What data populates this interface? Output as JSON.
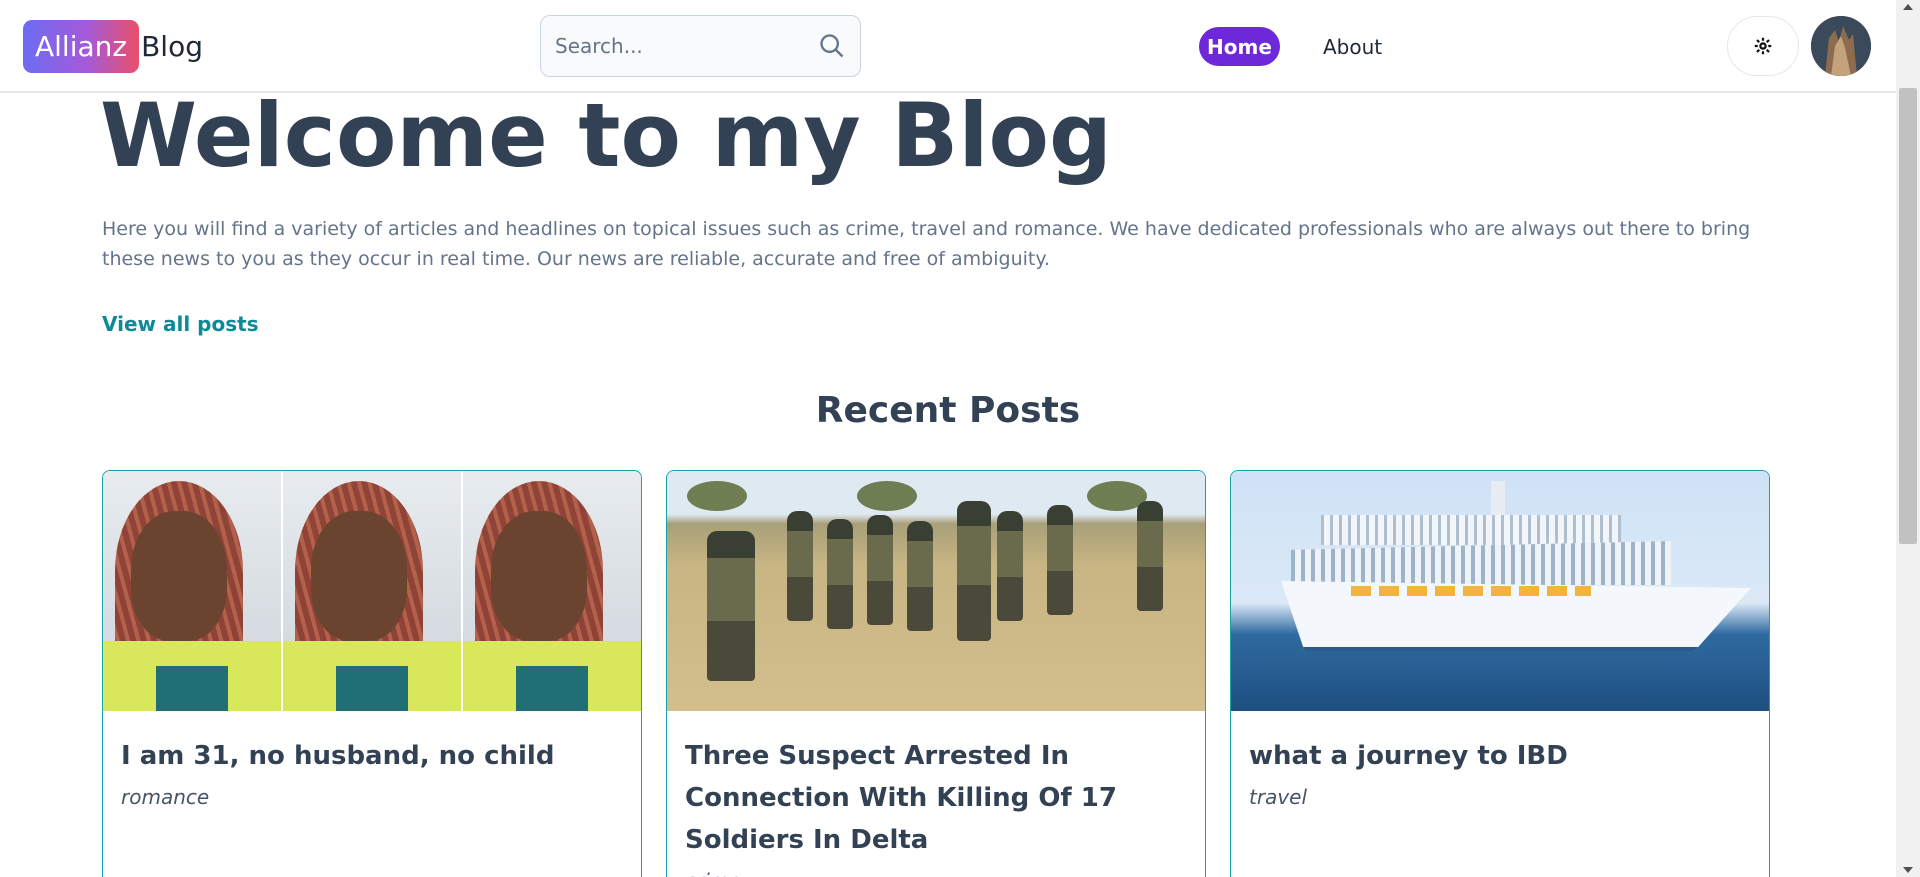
{
  "header": {
    "logo_badge": "Allianz",
    "logo_text": "Blog",
    "search_placeholder": "Search...",
    "nav": {
      "home": "Home",
      "about": "About"
    },
    "theme_icon": "gear-icon"
  },
  "hero": {
    "title": "Welcome to my Blog",
    "text": "Here you will find a variety of articles and headlines on topical issues such as crime, travel and romance. We have dedicated professionals who are always out there to bring these news to you as they occur in real time. Our news are reliable, accurate and free of ambiguity.",
    "view_all": "View all posts"
  },
  "recent": {
    "title": "Recent Posts",
    "posts": [
      {
        "title": "I am 31, no husband, no child",
        "category": "romance"
      },
      {
        "title": "Three Suspect Arrested In Connection With Killing Of 17 Soldiers In Delta",
        "category": "crime"
      },
      {
        "title": "what a journey to IBD",
        "category": "travel"
      }
    ]
  },
  "colors": {
    "brand_gradient": [
      "#6d6cf4",
      "#ea4f6a"
    ],
    "nav_active": "#6d28d9",
    "link": "#0e8a96",
    "card_border": "#14a3ad"
  }
}
